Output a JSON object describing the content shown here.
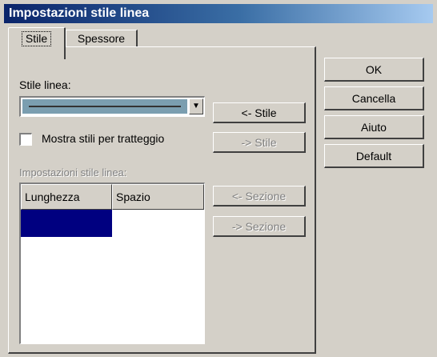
{
  "window": {
    "title": "Impostazioni stile linea"
  },
  "tabs": [
    {
      "label": "Stile",
      "active": true
    },
    {
      "label": "Spessore",
      "active": false
    }
  ],
  "stile_tab": {
    "stile_linea_label": "Stile linea:",
    "combo_selected": "solid-line",
    "checkbox_label": "Mostra stili per tratteggio",
    "checkbox_checked": false,
    "section_label": "Impostazioni stile linea:",
    "table": {
      "headers": [
        "Lunghezza",
        "Spazio"
      ],
      "rows": [
        [
          "",
          ""
        ]
      ],
      "selected_cell_color": "#000080"
    },
    "buttons": {
      "stile_left": "<- Stile",
      "stile_right": "-> Stile",
      "sezione_left": "<- Sezione",
      "sezione_right": "-> Sezione"
    }
  },
  "dialog_buttons": {
    "ok": "OK",
    "cancel": "Cancella",
    "help": "Aiuto",
    "default": "Default"
  },
  "colors": {
    "face": "#d4d0c8",
    "title_start": "#0a246a",
    "title_end": "#a6caf0",
    "combo_highlight": "#7b9eb0"
  }
}
